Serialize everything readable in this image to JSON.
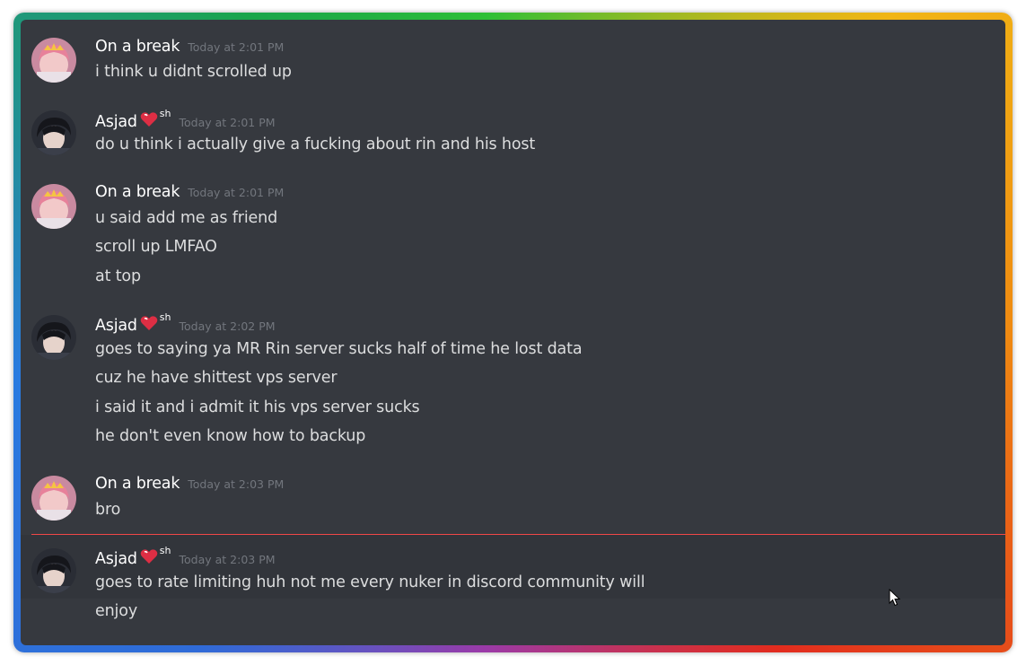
{
  "users": {
    "on_break": {
      "name": "On a break"
    },
    "asjad": {
      "name": "Asjad",
      "decoration_suffix": "sh"
    }
  },
  "groups": [
    {
      "user": "On a break",
      "time": "Today at 2:01 PM",
      "lines": [
        "i think u didnt scrolled up"
      ]
    },
    {
      "user": "Asjad",
      "time": "Today at 2:01 PM",
      "lines": [
        "do u think i actually give a fucking about rin and his host"
      ]
    },
    {
      "user": "On a break",
      "time": "Today at 2:01 PM",
      "lines": [
        "u said add me as friend",
        "scroll up LMFAO",
        "at top"
      ]
    },
    {
      "user": "Asjad",
      "time": "Today at 2:02 PM",
      "lines": [
        "goes to saying ya MR Rin server sucks half of time he lost data",
        "cuz he have shittest vps server",
        "i said it and i admit it his vps server sucks",
        "he don't even know how to backup"
      ]
    },
    {
      "user": "On a break",
      "time": "Today at 2:03 PM",
      "lines": [
        "bro"
      ]
    },
    {
      "user": "Asjad",
      "time": "Today at 2:03 PM",
      "lines": [
        "goes to rate limiting huh not me every nuker in discord community will",
        "enjoy"
      ]
    }
  ],
  "colors": {
    "background": "#36393f",
    "username": "#ffffff",
    "message_text": "#dcddde",
    "timestamp": "#72767d",
    "new_messages_divider": "#f04747"
  },
  "icons": {
    "heart_decoration": "red-heart-icon",
    "cursor": "mouse-pointer-icon"
  }
}
